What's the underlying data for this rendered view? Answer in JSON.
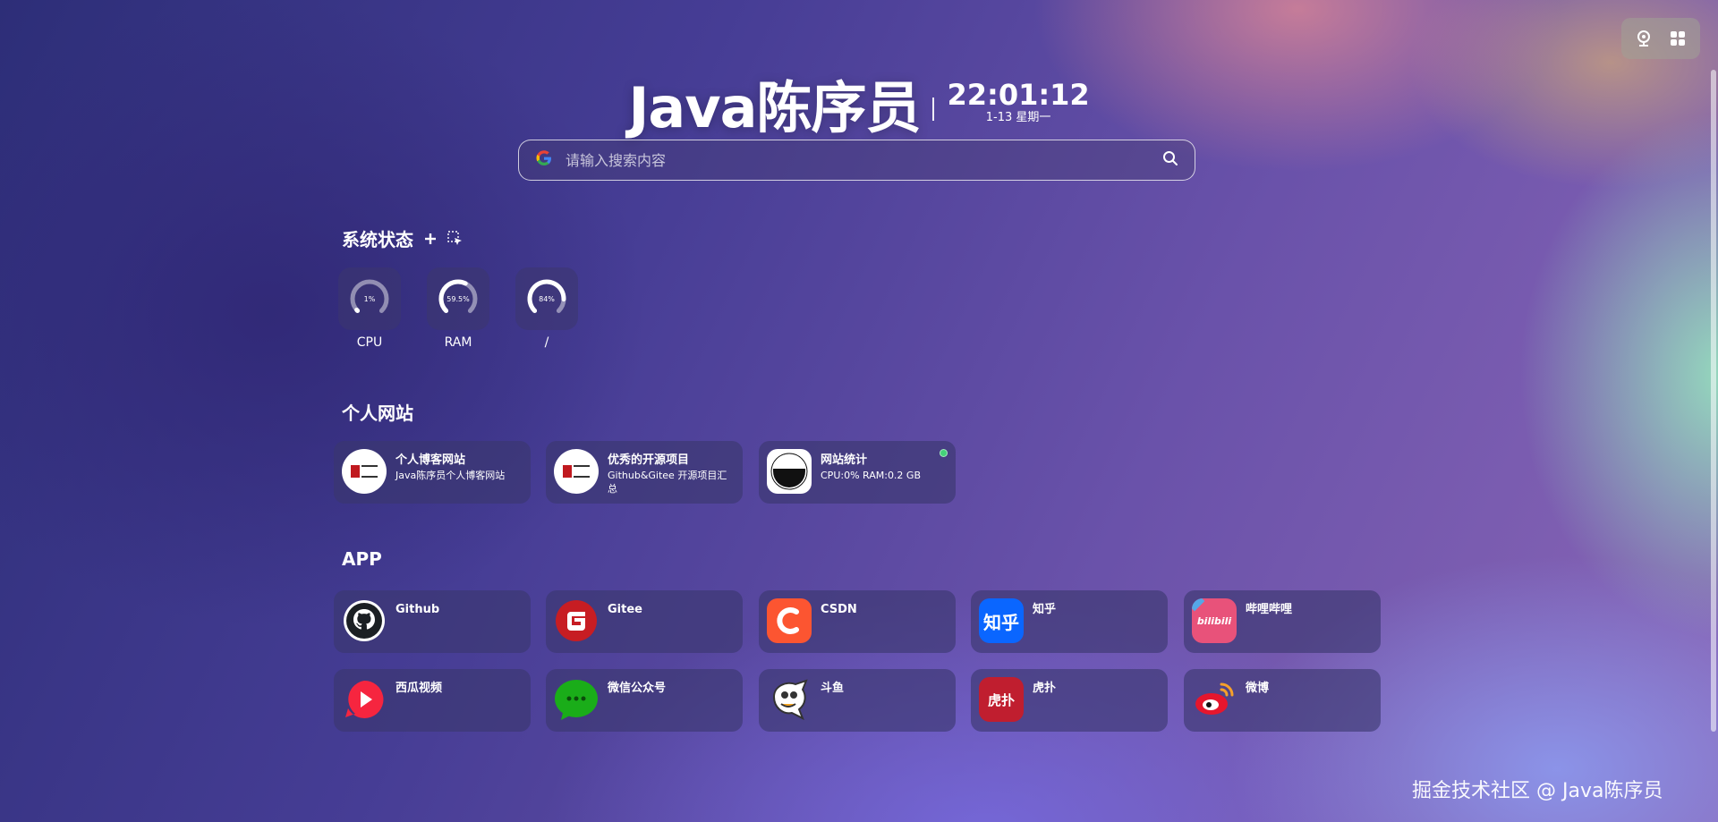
{
  "header": {
    "brand": "Java陈序员",
    "time": "22:01:12",
    "date": "1-13 星期一"
  },
  "search": {
    "placeholder": "请输入搜索内容",
    "engine_icon": "google-icon"
  },
  "top_tools": [
    {
      "icon": "network-icon"
    },
    {
      "icon": "apps-grid-icon"
    }
  ],
  "system_status": {
    "title": "系统状态",
    "add_icon": "plus-icon",
    "select_icon": "select-cursor-icon",
    "gauges": [
      {
        "label": "CPU",
        "value_text": "1%",
        "value": 1
      },
      {
        "label": "RAM",
        "value_text": "59.5%",
        "value": 59.5
      },
      {
        "label": "/",
        "value_text": "84%",
        "value": 84
      }
    ]
  },
  "personal_sites": {
    "title": "个人网站",
    "items": [
      {
        "title": "个人博客网站",
        "desc": "Java陈序员个人博客网站",
        "icon": "java-logo"
      },
      {
        "title": "优秀的开源项目",
        "desc": "Github&Gitee 开源项目汇总",
        "icon": "java-logo"
      },
      {
        "title": "网站统计",
        "desc": "CPU:0% RAM:0.2 GB",
        "icon": "stats-icon",
        "status": "online"
      }
    ]
  },
  "apps": {
    "title": "APP",
    "items": [
      {
        "title": "Github",
        "icon": "github-icon"
      },
      {
        "title": "Gitee",
        "icon": "gitee-icon"
      },
      {
        "title": "CSDN",
        "icon": "csdn-icon"
      },
      {
        "title": "知乎",
        "icon": "zhihu-icon",
        "icon_text": "知乎"
      },
      {
        "title": "哔哩哔哩",
        "icon": "bilibili-icon",
        "icon_text": "bilibili"
      },
      {
        "title": "西瓜视频",
        "icon": "xigua-icon"
      },
      {
        "title": "微信公众号",
        "icon": "wechat-icon"
      },
      {
        "title": "斗鱼",
        "icon": "douyu-icon"
      },
      {
        "title": "虎扑",
        "icon": "hupu-icon",
        "icon_text": "虎扑"
      },
      {
        "title": "微博",
        "icon": "weibo-icon"
      }
    ]
  },
  "watermark": "掘金技术社区 @ Java陈序员",
  "colors": {
    "status_online": "#45d17a",
    "csdn": "#fc5531",
    "zhihu": "#0a66ff",
    "gitee": "#c71d23",
    "wechat": "#1aad19"
  }
}
